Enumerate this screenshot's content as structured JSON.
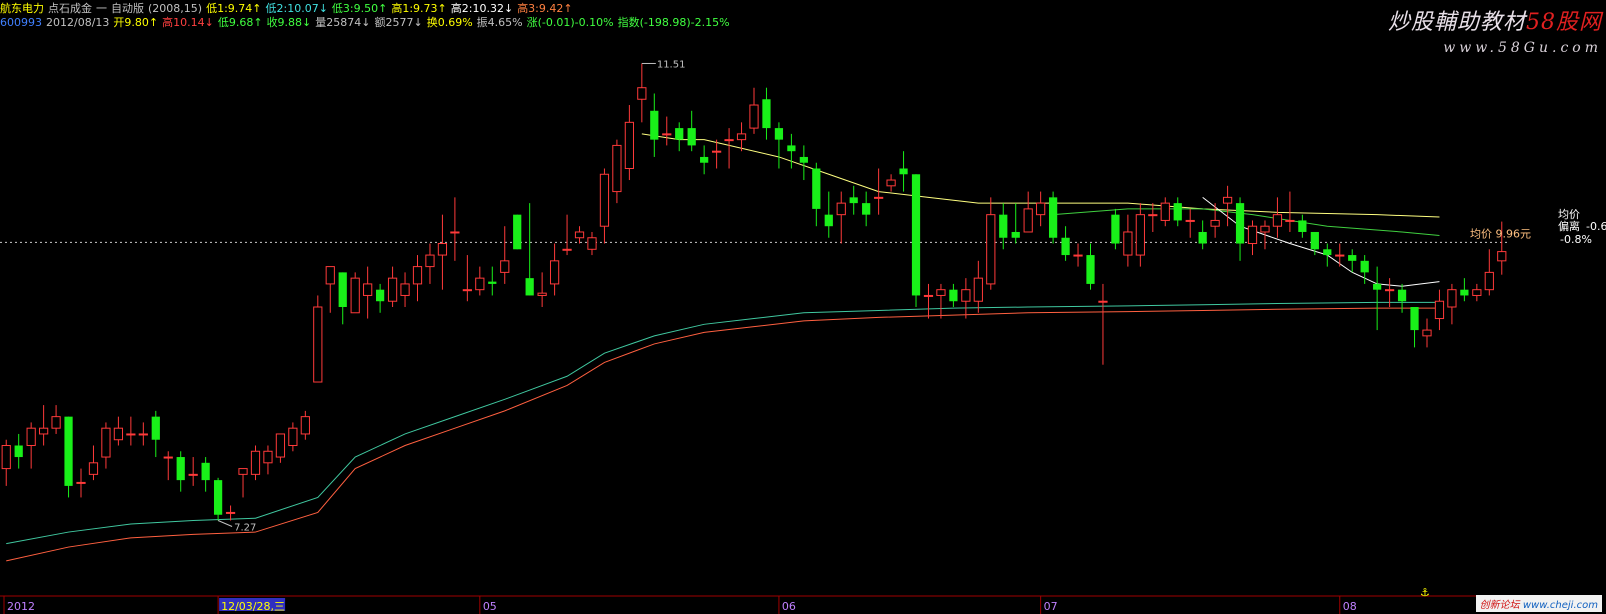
{
  "header": {
    "line1": [
      {
        "text": "航东电力",
        "color": "#ffff00"
      },
      {
        "text": "点石成金",
        "color": "#c0c0c0"
      },
      {
        "text": "一",
        "color": "#c0c0c0"
      },
      {
        "text": "自动版",
        "color": "#c0c0c0"
      },
      {
        "text": "(2008,15)",
        "color": "#c0c0c0"
      },
      {
        "text": "低1:9.74↑",
        "color": "#ffff00"
      },
      {
        "text": "低2:10.07↓",
        "color": "#40e0e0"
      },
      {
        "text": "低3:9.50↑",
        "color": "#40ff40"
      },
      {
        "text": "高1:9.73↑",
        "color": "#ffff00"
      },
      {
        "text": "高2:10.32↓",
        "color": "#ffffff"
      },
      {
        "text": "高3:9.42↑",
        "color": "#ff8040"
      }
    ],
    "line2": [
      {
        "text": "600993",
        "color": "#4080ff"
      },
      {
        "text": "2012/08/13",
        "color": "#c0c0c0"
      },
      {
        "text": "开9.80↑",
        "color": "#ffff00"
      },
      {
        "text": "高10.14↓",
        "color": "#ff4040"
      },
      {
        "text": "低9.68↑",
        "color": "#40ff40"
      },
      {
        "text": "收9.88↓",
        "color": "#40ff40"
      },
      {
        "text": "量25874↓",
        "color": "#c0c0c0"
      },
      {
        "text": "额2577↓",
        "color": "#c0c0c0"
      },
      {
        "text": "换0.69%",
        "color": "#ffff00"
      },
      {
        "text": "振4.65%",
        "color": "#c0c0c0"
      },
      {
        "text": "涨(-0.01)-0.10%",
        "color": "#40ff40"
      },
      {
        "text": "指数(-198.98)-2.15%",
        "color": "#40ff40"
      }
    ]
  },
  "watermark": {
    "title_main": "炒股輔助教材",
    "title_brand": "58股网",
    "url": "www.58Gu.com"
  },
  "bottom_badge": {
    "text": "创新论坛",
    "site": "www.cheji.com"
  },
  "chart_data": {
    "type": "candlestick",
    "ylim": [
      7.0,
      11.8
    ],
    "reference_price": 9.96,
    "annotations": {
      "high_label": "11.51",
      "low_label": "7.27",
      "avg_price_label": "均价 9.96元",
      "side_labels": [
        "均价",
        "偏离",
        "-0.6",
        "-0.8%"
      ]
    },
    "x_axis_labels": [
      {
        "index": 0,
        "text": "2012"
      },
      {
        "index": 17,
        "text": "12/03/28,三",
        "highlight": true
      },
      {
        "index": 38,
        "text": "05"
      },
      {
        "index": 62,
        "text": "06"
      },
      {
        "index": 83,
        "text": "07"
      },
      {
        "index": 107,
        "text": "08"
      }
    ],
    "candles": [
      [
        8.0,
        8.2,
        8.25,
        7.85
      ],
      [
        8.2,
        8.1,
        8.3,
        8.0
      ],
      [
        8.2,
        8.35,
        8.4,
        8.0
      ],
      [
        8.3,
        8.35,
        8.55,
        8.2
      ],
      [
        8.35,
        8.45,
        8.55,
        8.3
      ],
      [
        8.45,
        7.85,
        8.45,
        7.75
      ],
      [
        7.88,
        7.88,
        8.0,
        7.75
      ],
      [
        7.95,
        8.05,
        8.2,
        7.9
      ],
      [
        8.1,
        8.35,
        8.4,
        8.0
      ],
      [
        8.25,
        8.35,
        8.45,
        8.2
      ],
      [
        8.3,
        8.3,
        8.45,
        8.2
      ],
      [
        8.3,
        8.3,
        8.4,
        8.2
      ],
      [
        8.45,
        8.25,
        8.5,
        8.1
      ],
      [
        8.1,
        8.1,
        8.15,
        7.9
      ],
      [
        8.1,
        7.9,
        8.15,
        7.8
      ],
      [
        7.95,
        7.95,
        8.1,
        7.85
      ],
      [
        8.05,
        7.9,
        8.1,
        7.8
      ],
      [
        7.9,
        7.6,
        7.92,
        7.55
      ],
      [
        7.62,
        7.62,
        7.68,
        7.55
      ],
      [
        7.95,
        8.0,
        8.0,
        7.75
      ],
      [
        7.95,
        8.15,
        8.2,
        7.9
      ],
      [
        8.05,
        8.15,
        8.2,
        7.95
      ],
      [
        8.1,
        8.3,
        8.3,
        8.05
      ],
      [
        8.2,
        8.35,
        8.4,
        8.15
      ],
      [
        8.3,
        8.45,
        8.5,
        8.25
      ],
      [
        8.75,
        9.4,
        9.5,
        8.75
      ],
      [
        9.6,
        9.75,
        9.75,
        9.35
      ],
      [
        9.7,
        9.4,
        9.7,
        9.25
      ],
      [
        9.35,
        9.65,
        9.7,
        9.35
      ],
      [
        9.5,
        9.6,
        9.75,
        9.3
      ],
      [
        9.55,
        9.45,
        9.6,
        9.35
      ],
      [
        9.45,
        9.65,
        9.75,
        9.4
      ],
      [
        9.5,
        9.6,
        9.7,
        9.4
      ],
      [
        9.6,
        9.75,
        9.85,
        9.45
      ],
      [
        9.75,
        9.85,
        9.95,
        9.6
      ],
      [
        9.85,
        9.95,
        10.2,
        9.55
      ],
      [
        10.05,
        10.05,
        10.35,
        9.8
      ],
      [
        9.55,
        9.55,
        9.85,
        9.45
      ],
      [
        9.55,
        9.65,
        9.75,
        9.5
      ],
      [
        9.62,
        9.6,
        9.75,
        9.5
      ],
      [
        9.7,
        9.8,
        10.1,
        9.6
      ],
      [
        10.2,
        9.9,
        10.2,
        9.9
      ],
      [
        9.65,
        9.5,
        10.3,
        9.5
      ],
      [
        9.5,
        9.52,
        9.7,
        9.4
      ],
      [
        9.6,
        9.8,
        9.95,
        9.5
      ],
      [
        9.9,
        9.9,
        10.2,
        9.85
      ],
      [
        10.0,
        10.05,
        10.1,
        9.95
      ],
      [
        9.9,
        10.0,
        10.05,
        9.85
      ],
      [
        10.1,
        10.55,
        10.6,
        9.95
      ],
      [
        10.4,
        10.8,
        10.85,
        10.3
      ],
      [
        10.6,
        11.0,
        11.15,
        10.5
      ],
      [
        11.2,
        11.3,
        11.51,
        11.0
      ],
      [
        11.1,
        10.85,
        11.25,
        10.7
      ],
      [
        10.9,
        10.9,
        11.05,
        10.8
      ],
      [
        10.95,
        10.85,
        11.0,
        10.75
      ],
      [
        10.95,
        10.8,
        11.1,
        10.75
      ],
      [
        10.7,
        10.65,
        10.8,
        10.55
      ],
      [
        10.75,
        10.75,
        10.85,
        10.6
      ],
      [
        10.85,
        10.85,
        10.95,
        10.6
      ],
      [
        10.85,
        10.9,
        11.0,
        10.75
      ],
      [
        10.95,
        11.15,
        11.3,
        10.9
      ],
      [
        11.2,
        10.95,
        11.3,
        10.85
      ],
      [
        10.95,
        10.85,
        11.0,
        10.6
      ],
      [
        10.8,
        10.75,
        10.9,
        10.6
      ],
      [
        10.7,
        10.65,
        10.8,
        10.5
      ],
      [
        10.6,
        10.25,
        10.65,
        10.1
      ],
      [
        10.2,
        10.1,
        10.4,
        10.0
      ],
      [
        10.2,
        10.3,
        10.4,
        9.95
      ],
      [
        10.35,
        10.3,
        10.45,
        10.2
      ],
      [
        10.3,
        10.2,
        10.4,
        10.1
      ],
      [
        10.35,
        10.35,
        10.6,
        10.2
      ],
      [
        10.45,
        10.5,
        10.55,
        10.4
      ],
      [
        10.6,
        10.55,
        10.75,
        10.4
      ],
      [
        10.55,
        9.5,
        10.55,
        9.4
      ],
      [
        9.5,
        9.5,
        9.6,
        9.3
      ],
      [
        9.5,
        9.55,
        9.6,
        9.3
      ],
      [
        9.55,
        9.45,
        9.6,
        9.4
      ],
      [
        9.45,
        9.55,
        9.65,
        9.3
      ],
      [
        9.45,
        9.65,
        9.8,
        9.35
      ],
      [
        9.6,
        10.2,
        10.35,
        9.55
      ],
      [
        10.2,
        10.0,
        10.3,
        9.9
      ],
      [
        10.05,
        10.0,
        10.3,
        9.95
      ],
      [
        10.05,
        10.25,
        10.4,
        10.05
      ],
      [
        10.2,
        10.3,
        10.4,
        10.1
      ],
      [
        10.35,
        10.0,
        10.4,
        9.95
      ],
      [
        10.0,
        9.85,
        10.1,
        9.8
      ],
      [
        9.85,
        9.85,
        9.95,
        9.75
      ],
      [
        9.85,
        9.6,
        9.95,
        9.55
      ],
      [
        9.45,
        9.45,
        9.6,
        8.9
      ],
      [
        10.2,
        9.95,
        10.25,
        9.9
      ],
      [
        9.85,
        10.05,
        10.2,
        9.75
      ],
      [
        9.85,
        10.2,
        10.3,
        9.75
      ],
      [
        10.2,
        10.2,
        10.3,
        10.05
      ],
      [
        10.15,
        10.3,
        10.35,
        10.1
      ],
      [
        10.3,
        10.15,
        10.35,
        10.1
      ],
      [
        10.15,
        10.15,
        10.25,
        10.0
      ],
      [
        10.05,
        9.95,
        10.15,
        9.9
      ],
      [
        10.1,
        10.15,
        10.3,
        10.0
      ],
      [
        10.3,
        10.35,
        10.45,
        10.1
      ],
      [
        10.3,
        9.95,
        10.35,
        9.8
      ],
      [
        9.95,
        10.1,
        10.15,
        9.85
      ],
      [
        10.05,
        10.1,
        10.15,
        9.9
      ],
      [
        10.1,
        10.2,
        10.35,
        10.0
      ],
      [
        10.15,
        10.15,
        10.4,
        10.05
      ],
      [
        10.15,
        10.05,
        10.2,
        10.0
      ],
      [
        10.05,
        9.9,
        10.05,
        9.85
      ],
      [
        9.9,
        9.85,
        9.95,
        9.75
      ],
      [
        9.85,
        9.85,
        9.95,
        9.75
      ],
      [
        9.85,
        9.8,
        9.9,
        9.7
      ],
      [
        9.8,
        9.7,
        9.85,
        9.6
      ],
      [
        9.6,
        9.55,
        9.75,
        9.2
      ],
      [
        9.55,
        9.55,
        9.65,
        9.4
      ],
      [
        9.55,
        9.45,
        9.6,
        9.35
      ],
      [
        9.4,
        9.2,
        9.4,
        9.05
      ],
      [
        9.15,
        9.2,
        9.3,
        9.05
      ],
      [
        9.3,
        9.45,
        9.55,
        9.2
      ],
      [
        9.4,
        9.55,
        9.6,
        9.25
      ],
      [
        9.55,
        9.5,
        9.65,
        9.45
      ],
      [
        9.5,
        9.55,
        9.6,
        9.45
      ],
      [
        9.55,
        9.7,
        9.9,
        9.5
      ],
      [
        9.8,
        9.88,
        10.14,
        9.68
      ]
    ],
    "series": [
      {
        "color": "#ffff80",
        "values": [
          [
            51,
            10.9
          ],
          [
            54,
            10.85
          ],
          [
            56,
            10.85
          ],
          [
            58,
            10.8
          ],
          [
            62,
            10.7
          ],
          [
            66,
            10.55
          ],
          [
            70,
            10.4
          ],
          [
            74,
            10.35
          ],
          [
            78,
            10.3
          ],
          [
            84,
            10.3
          ],
          [
            90,
            10.3
          ],
          [
            96,
            10.25
          ],
          [
            102,
            10.22
          ],
          [
            110,
            10.2
          ],
          [
            115,
            10.18
          ]
        ]
      },
      {
        "color": "#40d040",
        "values": [
          [
            84,
            10.2
          ],
          [
            90,
            10.25
          ],
          [
            96,
            10.25
          ],
          [
            100,
            10.2
          ],
          [
            106,
            10.1
          ],
          [
            112,
            10.05
          ],
          [
            115,
            10.02
          ]
        ]
      },
      {
        "color": "#ffffff",
        "values": [
          [
            96,
            10.35
          ],
          [
            99,
            10.1
          ],
          [
            103,
            9.95
          ],
          [
            106,
            9.85
          ],
          [
            108,
            9.7
          ],
          [
            110,
            9.6
          ],
          [
            112,
            9.58
          ],
          [
            115,
            9.62
          ]
        ]
      },
      {
        "color": "#40c8a0",
        "values": [
          [
            0,
            7.35
          ],
          [
            5,
            7.45
          ],
          [
            10,
            7.52
          ],
          [
            15,
            7.55
          ],
          [
            20,
            7.57
          ],
          [
            25,
            7.75
          ],
          [
            28,
            8.1
          ],
          [
            32,
            8.3
          ],
          [
            36,
            8.45
          ],
          [
            40,
            8.6
          ],
          [
            45,
            8.8
          ],
          [
            48,
            9.0
          ],
          [
            52,
            9.15
          ],
          [
            56,
            9.25
          ],
          [
            60,
            9.3
          ],
          [
            64,
            9.35
          ],
          [
            70,
            9.37
          ],
          [
            76,
            9.39
          ],
          [
            82,
            9.4
          ],
          [
            90,
            9.41
          ],
          [
            96,
            9.42
          ],
          [
            102,
            9.43
          ],
          [
            110,
            9.44
          ],
          [
            115,
            9.44
          ]
        ]
      },
      {
        "color": "#ff6040",
        "values": [
          [
            0,
            7.2
          ],
          [
            5,
            7.32
          ],
          [
            10,
            7.4
          ],
          [
            15,
            7.43
          ],
          [
            20,
            7.45
          ],
          [
            25,
            7.62
          ],
          [
            28,
            8.0
          ],
          [
            32,
            8.2
          ],
          [
            36,
            8.35
          ],
          [
            40,
            8.5
          ],
          [
            45,
            8.72
          ],
          [
            48,
            8.92
          ],
          [
            52,
            9.08
          ],
          [
            56,
            9.18
          ],
          [
            60,
            9.23
          ],
          [
            64,
            9.28
          ],
          [
            70,
            9.31
          ],
          [
            76,
            9.33
          ],
          [
            82,
            9.35
          ],
          [
            90,
            9.36
          ],
          [
            96,
            9.37
          ],
          [
            102,
            9.38
          ],
          [
            110,
            9.39
          ],
          [
            115,
            9.39
          ]
        ]
      }
    ]
  }
}
